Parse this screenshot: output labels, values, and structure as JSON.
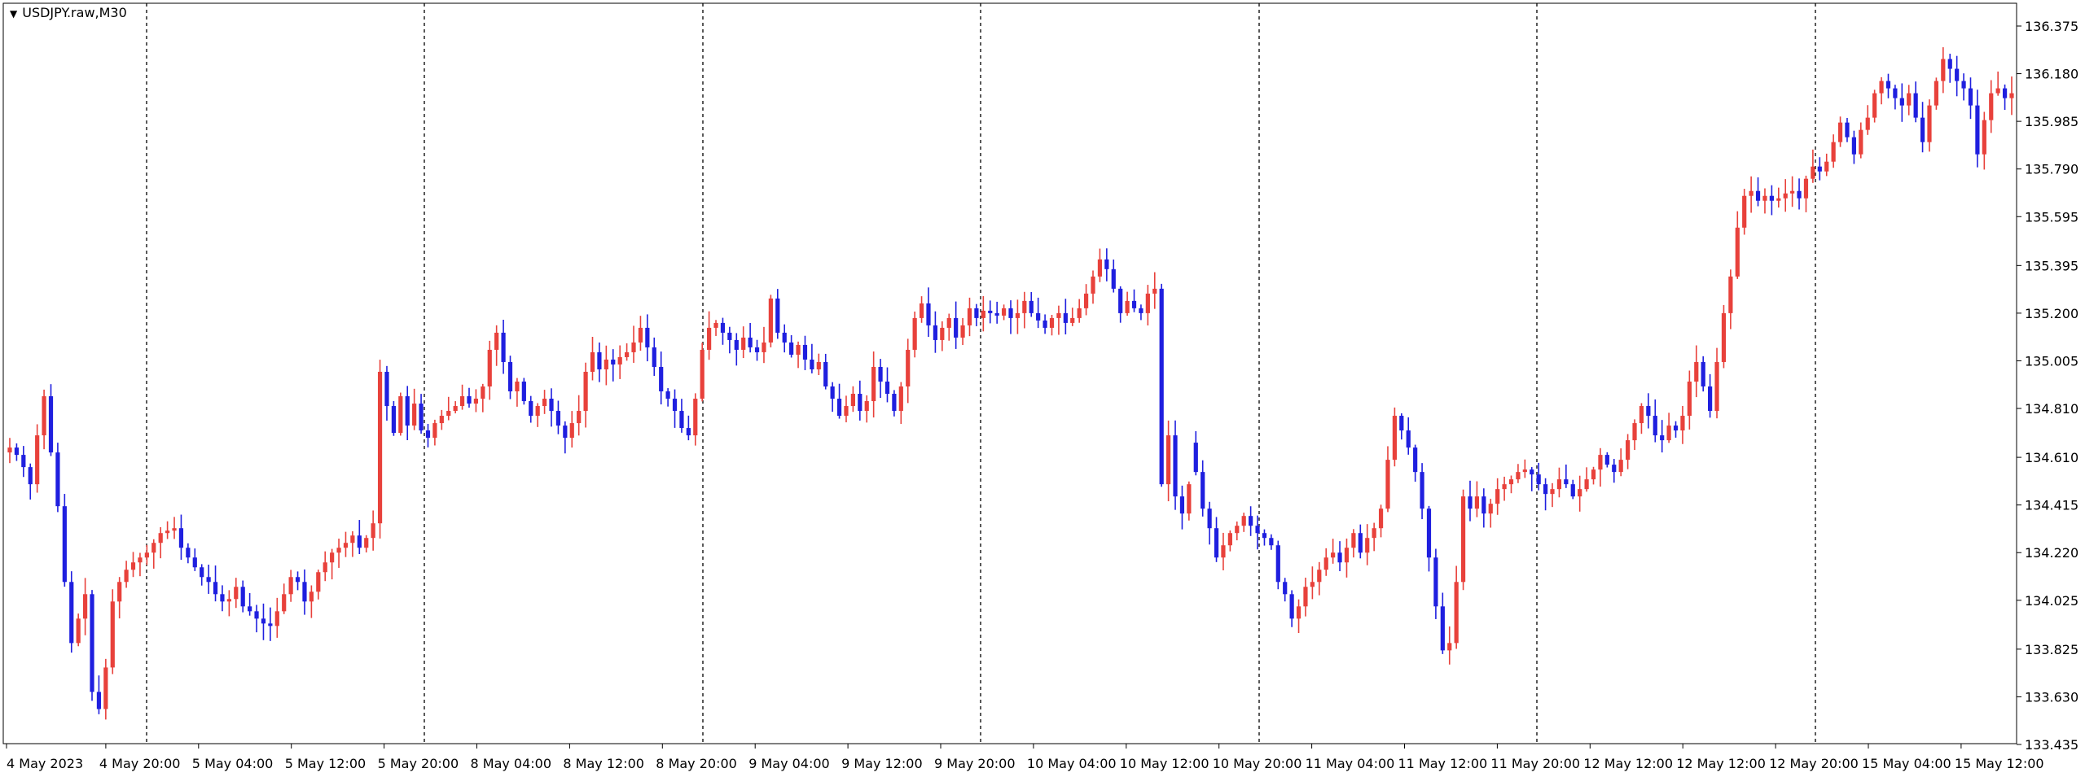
{
  "window": {
    "symbol_label": "USDJPY.raw,M30",
    "menu_icon": "triangle-down-icon"
  },
  "colors": {
    "bull": "#e8413b",
    "bear": "#1f1fdf",
    "grid": "#000000",
    "background": "#ffffff",
    "text": "#000000"
  },
  "chart_data": {
    "type": "candlestick",
    "symbol": "USDJPY.raw",
    "timeframe": "M30",
    "ylim": [
      133.435,
      136.47
    ],
    "y_ticks": [
      "136.375",
      "136.180",
      "135.985",
      "135.790",
      "135.595",
      "135.395",
      "135.200",
      "135.005",
      "134.810",
      "134.610",
      "134.415",
      "134.220",
      "134.025",
      "133.825",
      "133.630",
      "133.435"
    ],
    "x_ticks": [
      "4 May 2023",
      "4 May 20:00",
      "5 May 04:00",
      "5 May 12:00",
      "5 May 20:00",
      "8 May 04:00",
      "8 May 12:00",
      "8 May 20:00",
      "9 May 04:00",
      "9 May 12:00",
      "9 May 20:00",
      "10 May 04:00",
      "10 May 12:00",
      "10 May 20:00",
      "11 May 04:00",
      "11 May 12:00",
      "11 May 20:00",
      "12 May 12:00",
      "12 May 12:00",
      "12 May 20:00",
      "15 May 04:00",
      "15 May 12:00"
    ],
    "separators_after_tick": [
      1,
      4,
      7,
      10,
      13,
      16,
      19
    ],
    "grid": false,
    "legend": "none",
    "price_path": [
      134.65,
      134.62,
      134.57,
      134.5,
      134.7,
      134.86,
      134.63,
      134.41,
      134.1,
      133.85,
      133.95,
      134.05,
      133.65,
      133.58,
      133.75,
      134.02,
      134.1,
      134.15,
      134.18,
      134.2,
      134.22,
      134.26,
      134.3,
      134.31,
      134.32,
      134.24,
      134.2,
      134.16,
      134.12,
      134.1,
      134.05,
      134.02,
      134.03,
      134.08,
      134.0,
      133.98,
      133.95,
      133.93,
      133.92,
      133.98,
      134.05,
      134.12,
      134.1,
      134.02,
      134.06,
      134.14,
      134.18,
      134.22,
      134.24,
      134.26,
      134.29,
      134.24,
      134.28,
      134.34,
      134.96,
      134.82,
      134.71,
      134.86,
      134.74,
      134.83,
      134.72,
      134.69,
      134.75,
      134.78,
      134.8,
      134.82,
      134.86,
      134.83,
      134.85,
      134.9,
      135.05,
      135.12,
      135.0,
      134.88,
      134.92,
      134.84,
      134.78,
      134.82,
      134.85,
      134.8,
      134.74,
      134.69,
      134.75,
      134.8,
      134.96,
      135.04,
      134.97,
      135.01,
      134.99,
      135.02,
      135.04,
      135.08,
      135.14,
      135.06,
      134.98,
      134.88,
      134.85,
      134.8,
      134.73,
      134.7,
      134.85,
      135.05,
      135.14,
      135.16,
      135.12,
      135.09,
      135.05,
      135.1,
      135.06,
      135.04,
      135.08,
      135.26,
      135.12,
      135.08,
      135.03,
      135.07,
      135.01,
      134.97,
      135.0,
      134.9,
      134.85,
      134.78,
      134.82,
      134.87,
      134.8,
      134.84,
      134.98,
      134.92,
      134.87,
      134.8,
      134.9,
      135.05,
      135.18,
      135.24,
      135.15,
      135.09,
      135.14,
      135.18,
      135.1,
      135.15,
      135.22,
      135.18,
      135.21,
      135.2,
      135.19,
      135.22,
      135.18,
      135.2,
      135.25,
      135.2,
      135.17,
      135.14,
      135.18,
      135.2,
      135.16,
      135.18,
      135.22,
      135.28,
      135.35,
      135.42,
      135.38,
      135.3,
      135.2,
      135.25,
      135.22,
      135.2,
      135.28,
      135.3,
      134.5,
      134.7,
      134.45,
      134.38,
      134.5,
      134.55,
      134.4,
      134.32,
      134.2,
      134.25,
      134.3,
      134.33,
      134.37,
      134.33,
      134.3,
      134.28,
      134.25,
      134.1,
      134.05,
      133.95,
      134.0,
      134.08,
      134.1,
      134.15,
      134.2,
      134.22,
      134.18,
      134.24,
      134.3,
      134.22,
      134.28,
      134.32,
      134.4,
      134.6,
      134.78,
      134.72,
      134.65,
      134.55,
      134.4,
      134.2,
      134.0,
      133.82,
      133.85,
      134.1,
      134.45,
      134.4,
      134.45,
      134.38,
      134.42,
      134.48,
      134.5,
      134.52,
      134.55,
      134.56,
      134.54,
      134.5,
      134.46,
      134.48,
      134.52,
      134.5,
      134.45,
      134.48,
      134.52,
      134.56,
      134.62,
      134.58,
      134.55,
      134.6,
      134.68,
      134.75,
      134.82,
      134.78,
      134.7,
      134.68,
      134.74,
      134.72,
      134.78,
      134.92,
      135.0,
      134.9,
      134.8,
      135.0,
      135.2,
      135.35,
      135.55,
      135.68,
      135.7,
      135.66,
      135.68,
      135.66,
      135.67,
      135.69,
      135.7,
      135.67,
      135.75,
      135.8,
      135.78,
      135.82,
      135.9,
      135.98,
      135.92,
      135.85,
      135.95,
      136.0,
      136.1,
      136.15,
      136.12,
      136.08,
      136.05,
      136.1,
      136.0,
      135.9,
      136.05,
      136.15,
      136.24,
      136.2,
      136.15,
      136.12,
      136.05,
      135.85,
      135.99,
      136.1,
      136.12,
      136.08,
      136.1
    ],
    "gap_after_index": 172,
    "last_price": 136.1
  }
}
